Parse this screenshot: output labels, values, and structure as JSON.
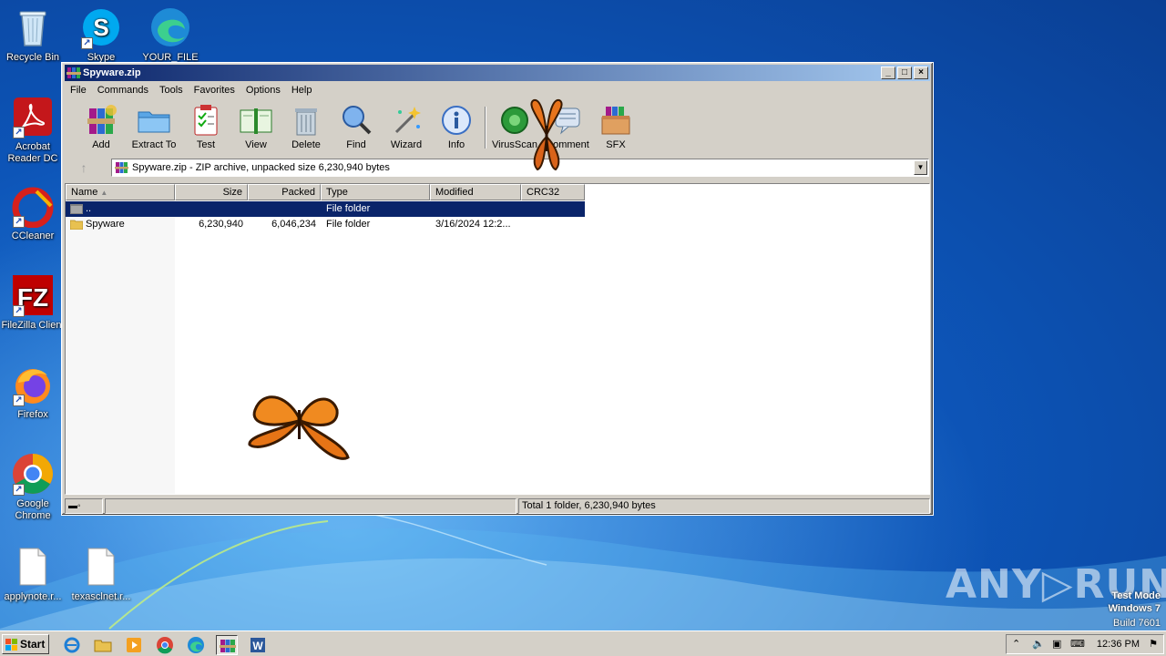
{
  "desktop": {
    "icons": [
      {
        "label": "Recycle Bin"
      },
      {
        "label": "Skype"
      },
      {
        "label": "YOUR_FILE"
      },
      {
        "label": "Acrobat Reader DC"
      },
      {
        "label": "CCleaner"
      },
      {
        "label": "FileZilla Client"
      },
      {
        "label": "Firefox"
      },
      {
        "label": "Google Chrome"
      },
      {
        "label": "applynote.r..."
      },
      {
        "label": "texasclnet.r..."
      }
    ],
    "watermark": {
      "brand": "ANY▷RUN",
      "line1": "Test Mode",
      "line2": "Windows 7",
      "line3": "Build 7601"
    }
  },
  "window": {
    "title": "Spyware.zip",
    "menu": [
      "File",
      "Commands",
      "Tools",
      "Favorites",
      "Options",
      "Help"
    ],
    "toolbar": [
      {
        "label": "Add",
        "icon": "add-archive-icon"
      },
      {
        "label": "Extract To",
        "icon": "extract-folder-icon"
      },
      {
        "label": "Test",
        "icon": "test-clipboard-icon"
      },
      {
        "label": "View",
        "icon": "view-book-icon"
      },
      {
        "label": "Delete",
        "icon": "trash-icon"
      },
      {
        "label": "Find",
        "icon": "magnifier-icon"
      },
      {
        "label": "Wizard",
        "icon": "wand-icon"
      },
      {
        "label": "Info",
        "icon": "info-icon"
      },
      {
        "label": "VirusScan",
        "icon": "virus-icon"
      },
      {
        "label": "Comment",
        "icon": "comment-icon"
      },
      {
        "label": "SFX",
        "icon": "sfx-box-icon"
      }
    ],
    "address": "Spyware.zip - ZIP archive, unpacked size 6,230,940 bytes",
    "columns": [
      "Name",
      "Size",
      "Packed",
      "Type",
      "Modified",
      "CRC32"
    ],
    "rows": [
      {
        "name": "..",
        "size": "",
        "packed": "",
        "type": "File folder",
        "modified": "",
        "crc": "",
        "selected": true
      },
      {
        "name": "Spyware",
        "size": "6,230,940",
        "packed": "6,046,234",
        "type": "File folder",
        "modified": "3/16/2024 12:2...",
        "crc": "",
        "selected": false
      }
    ],
    "status": "Total 1 folder, 6,230,940 bytes"
  },
  "taskbar": {
    "start": "Start",
    "clock": "12:36 PM"
  }
}
